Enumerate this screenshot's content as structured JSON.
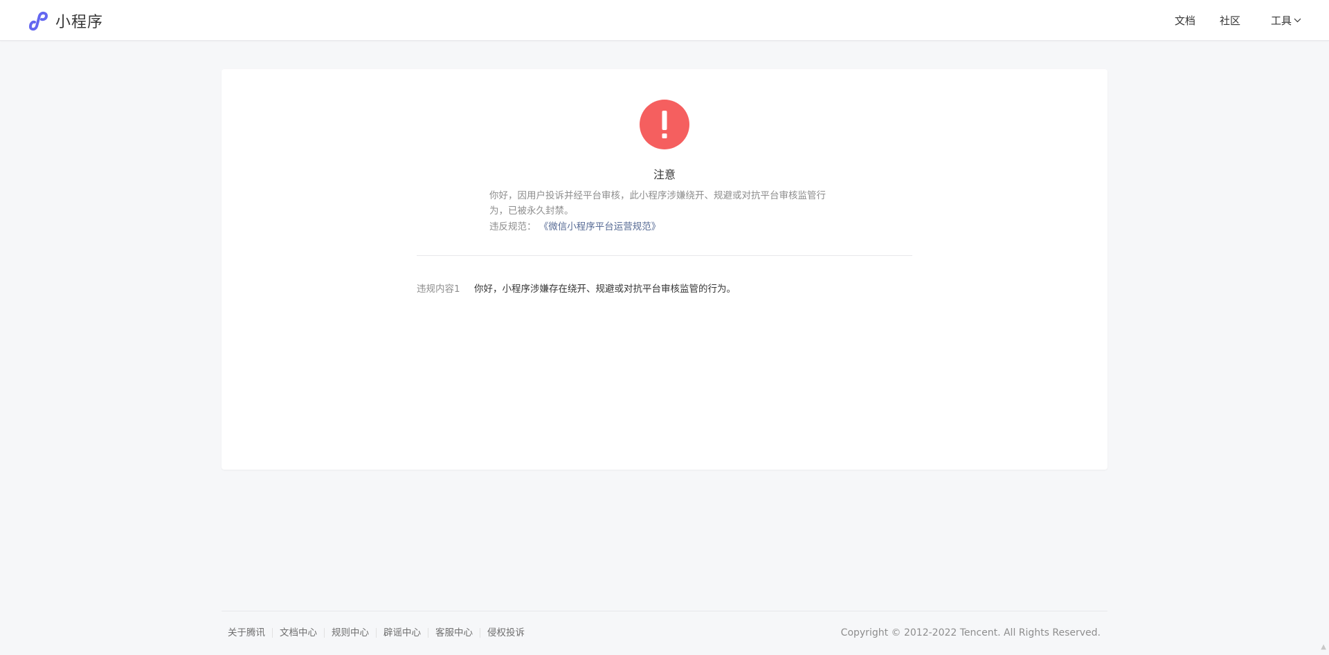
{
  "header": {
    "app_title": "小程序",
    "nav": {
      "docs": "文档",
      "community": "社区",
      "tools": "工具"
    }
  },
  "notice": {
    "icon": "exclamation-icon",
    "title": "注意",
    "description": "你好，因用户投诉并经平台审核，此小程序涉嫌绕开、规避或对抗平台审核监管行为，已被永久封禁。",
    "rule_label": "违反规范：",
    "rule_link": "《微信小程序平台运营规范》"
  },
  "violations": [
    {
      "label": "违规内容1",
      "text": "你好，小程序涉嫌存在绕开、规避或对抗平台审核监管的行为。"
    }
  ],
  "footer": {
    "links": [
      "关于腾讯",
      "文档中心",
      "规则中心",
      "辟谣中心",
      "客服中心",
      "侵权投诉"
    ],
    "copyright": "Copyright © 2012-2022 Tencent. All Rights Reserved."
  },
  "colors": {
    "warning": "#f55f5f",
    "link": "#576b95",
    "brand": "#6467f0"
  }
}
